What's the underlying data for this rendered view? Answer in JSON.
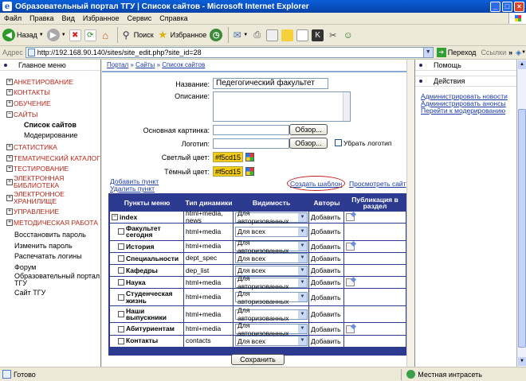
{
  "window": {
    "title": "Образовательный портал ТГУ | Список сайтов - Microsoft Internet Explorer"
  },
  "menu": [
    "Файл",
    "Правка",
    "Вид",
    "Избранное",
    "Сервис",
    "Справка"
  ],
  "toolbar": {
    "back": "Назад",
    "search": "Поиск",
    "favorites": "Избранное"
  },
  "address": {
    "label": "Адрес",
    "url": "http://192.168.90.140/sites/site_edit.php?site_id=28",
    "go": "Переход",
    "links": "Ссылки"
  },
  "left_panel": {
    "title": "Главное меню",
    "top_nodes": [
      "АНКЕТИРОВАНИЕ",
      "КОНТАКТЫ",
      "ОБУЧЕНИЕ"
    ],
    "sites_node": "САЙТЫ",
    "sites_children": [
      "Список сайтов",
      "Модерирование"
    ],
    "nodes_a": [
      "СТАТИСТИКА",
      "ТЕМАТИЧЕСКИЙ КАТАЛОГ",
      "ТЕСТИРОВАНИЕ"
    ],
    "two_line": [
      [
        "ЭЛЕКТРОННАЯ",
        "БИБЛИОТЕКА"
      ],
      [
        "ЭЛЕКТРОННОЕ",
        "ХРАНИЛИЩЕ"
      ]
    ],
    "nodes_b": [
      "УПРАВЛЕНИЕ",
      "МЕТОДИЧЕСКАЯ РАБОТА"
    ],
    "plain": [
      "Восстановить пароль",
      "Изменить пароль",
      "Распечатать логины",
      "Форум"
    ],
    "portal": [
      "Образовательный портал",
      "ТГУ"
    ],
    "site": "Сайт ТГУ"
  },
  "breadcrumb": [
    "Портал",
    "Сайты",
    "Список сайтов"
  ],
  "breadcrumb_sep": "»",
  "form": {
    "name_label": "Название:",
    "name_value": "Педегогический факультет",
    "desc_label": "Описание:",
    "image_label": "Основная картинка:",
    "logo_label": "Логотип:",
    "browse": "Обзор...",
    "remove_logo": "Убрать логотип",
    "light_label": "Светлый цвет:",
    "light_value": "#f5cd15",
    "dark_label": "Тёмный цвет:",
    "dark_value": "#f5cd15"
  },
  "links": {
    "add_item": "Добавить пункт",
    "remove_item": "Удалить пункт",
    "create_template": "Создать шаблон",
    "view_site": "Просмотреть сайт"
  },
  "table": {
    "headers": [
      "Пункты меню",
      "Тип динамики",
      "Видимость",
      "Авторы",
      "Публикация в раздел"
    ],
    "rows": [
      {
        "name": "index",
        "type": "html+media, news",
        "visibility": "Для авторизованных",
        "add": "Добавить",
        "pub": true,
        "root": true
      },
      {
        "name": "Факультет сегодня",
        "type": "html+media",
        "visibility": "Для всех",
        "add": "Добавить",
        "pub": false
      },
      {
        "name": "История",
        "type": "html+media",
        "visibility": "Для авторизованных",
        "add": "Добавить",
        "pub": true
      },
      {
        "name": "Специальности",
        "type": "dept_spec",
        "visibility": "Для всех",
        "add": "Добавить",
        "pub": false
      },
      {
        "name": "Кафедры",
        "type": "dep_list",
        "visibility": "Для всех",
        "add": "Добавить",
        "pub": false
      },
      {
        "name": "Наука",
        "type": "html+media",
        "visibility": "Для авторизованных",
        "add": "Добавить",
        "pub": true
      },
      {
        "name": "Студенческая жизнь",
        "type": "html+media",
        "visibility": "Для авторизованных",
        "add": "Добавить",
        "pub": false
      },
      {
        "name": "Наши выпускники",
        "type": "html+media",
        "visibility": "Для авторизованных",
        "add": "Добавить",
        "pub": false
      },
      {
        "name": "Абитуриентам",
        "type": "html+media",
        "visibility": "Для авторизованных",
        "add": "Добавить",
        "pub": true
      },
      {
        "name": "Контакты",
        "type": "contacts",
        "visibility": "Для всех",
        "add": "Добавить",
        "pub": false
      }
    ]
  },
  "save": "Сохранить",
  "right_panel": {
    "help": "Помощь",
    "actions": "Действия",
    "links": [
      "Администрировать новости",
      "Администрировать анонсы",
      "Перейти к модерированию"
    ]
  },
  "status": {
    "left": "Готово",
    "zone": "Местная интрасеть"
  },
  "colors": {
    "accent": "#f5cd15",
    "table_border": "#2c3a90",
    "link": "#1a3aa6",
    "menu_red": "#b8261a"
  }
}
